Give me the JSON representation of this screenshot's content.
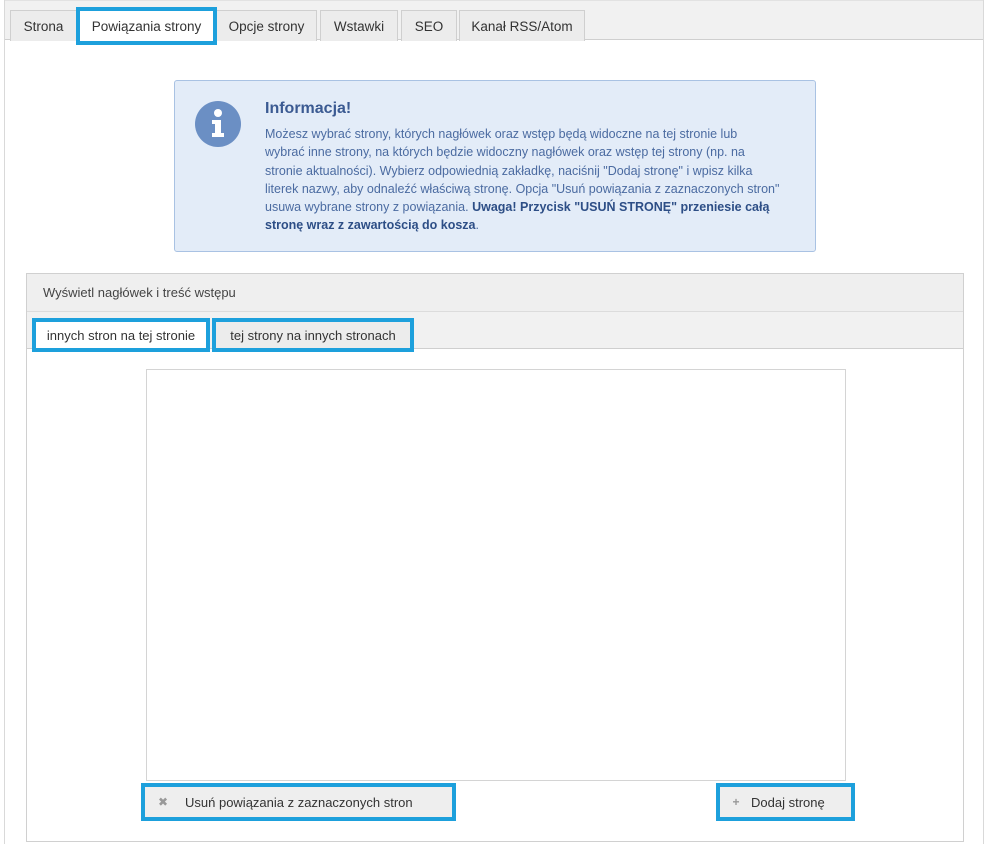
{
  "top_tabs": [
    {
      "label": "Strona"
    },
    {
      "label": "Powiązania strony"
    },
    {
      "label": "Opcje strony"
    },
    {
      "label": "Wstawki"
    },
    {
      "label": "SEO"
    },
    {
      "label": "Kanał RSS/Atom"
    }
  ],
  "info": {
    "icon": "info-icon",
    "title": "Informacja!",
    "text_part1": "Możesz wybrać strony, których nagłówek oraz wstęp będą widoczne na tej stronie lub wybrać inne strony, na których będzie widoczny nagłówek oraz wstęp tej strony (np. na stronie aktualności). Wybierz odpowiednią zakładkę, naciśnij \"Dodaj stronę\" i wpisz kilka literek nazwy, aby odnaleźć właściwą stronę. Opcja \"Usuń powiązania z zaznaczonych stron\" usuwa wybrane strony z powiązania. ",
    "text_bold": "Uwaga! Przycisk \"USUŃ STRONĘ\" przeniesie całą stronę wraz z zawartością do kosza",
    "text_end": "."
  },
  "panel": {
    "header": "Wyświetl nagłówek i treść wstępu",
    "tabs": [
      {
        "label": "innych stron na tej stronie"
      },
      {
        "label": "tej strony na innych stronach"
      }
    ],
    "remove_button": {
      "icon_glyph": "✖",
      "label": "Usuń powiązania z zaznaczonych stron"
    },
    "add_button": {
      "icon_glyph": "+",
      "label": "Dodaj stronę"
    }
  },
  "colors": {
    "highlight": "#1da0dc",
    "info_bg": "#e3ecf8",
    "info_title": "#3b5a92"
  }
}
